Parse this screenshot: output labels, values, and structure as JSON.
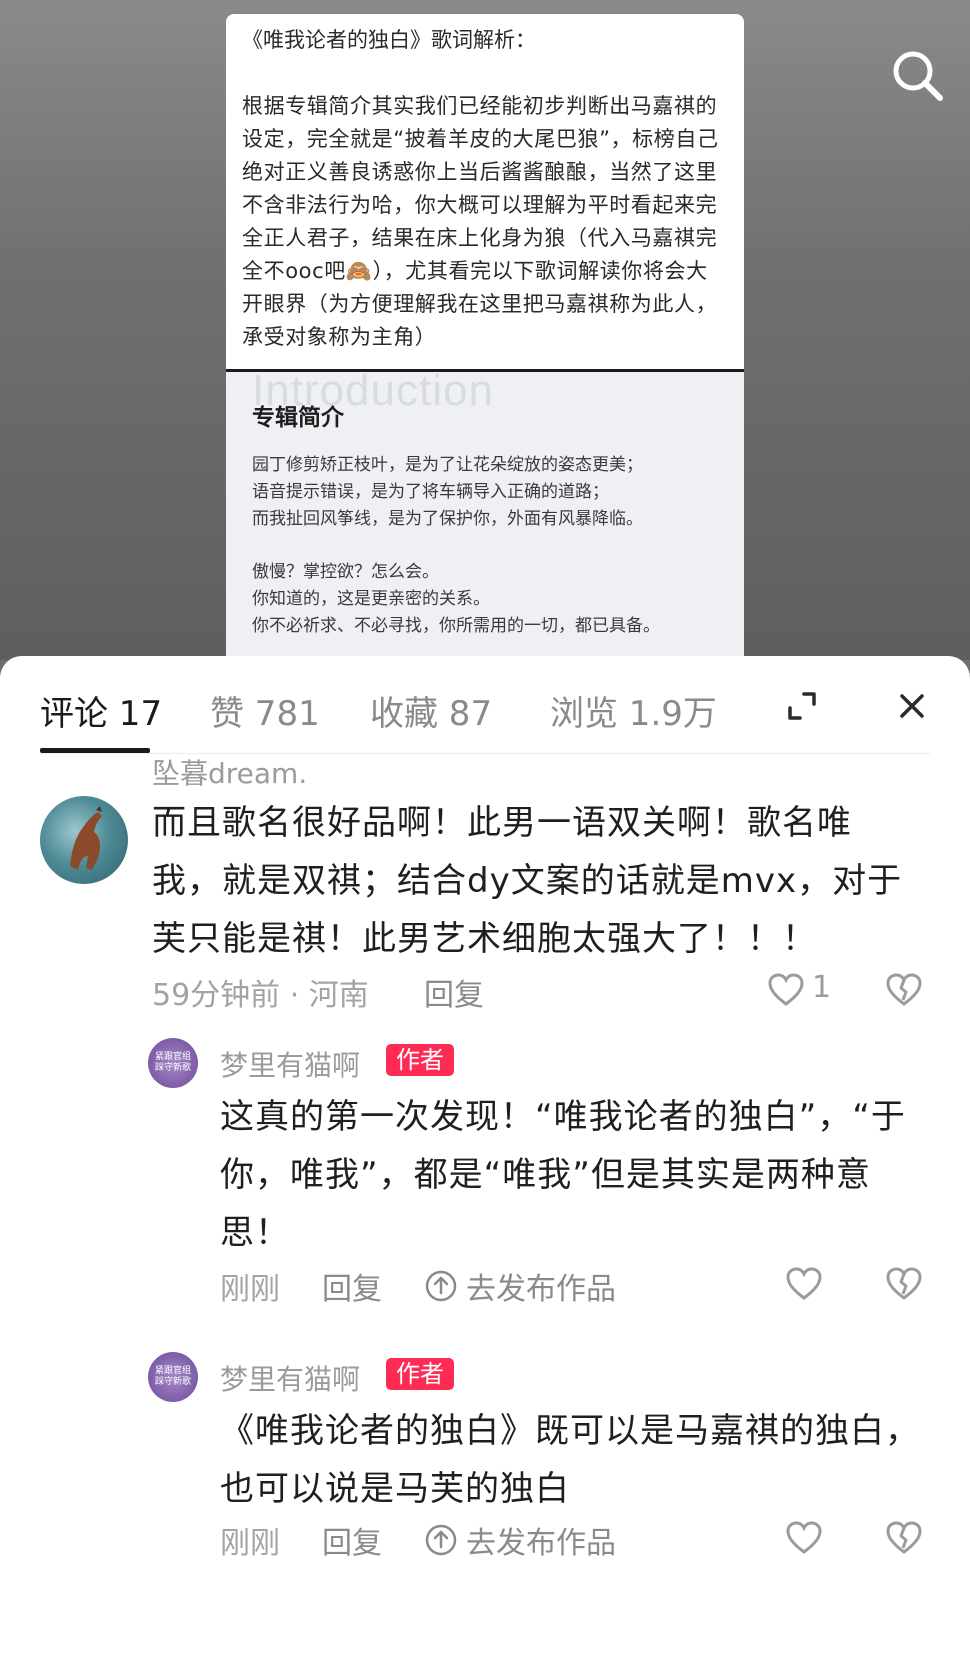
{
  "note": {
    "title": "《唯我论者的独白》歌词解析：",
    "body": "根据专辑简介其实我们已经能初步判断出马嘉祺的设定，完全就是“披着羊皮的大尾巴狼”，标榜自己绝对正义善良诱惑你上当后酱酱酿酿，当然了这里不含非法行为哈，你大概可以理解为平时看起来完全正人君子，结果在床上化身为狼（代入马嘉祺完全不ooc吧🙈），尤其看完以下歌词解读你将会大开眼界（为方便理解我在这里把马嘉祺称为此人，承受对象称为主角）"
  },
  "album": {
    "watermark": "Introduction",
    "heading": "专辑简介",
    "lines1": [
      "园丁修剪矫正枝叶，是为了让花朵绽放的姿态更美；",
      "语音提示错误，是为了将车辆导入正确的道路；",
      "而我扯回风筝线，是为了保护你，外面有风暴降临。"
    ],
    "lines2": [
      "傲慢？掌控欲？怎么会。",
      "你知道的，这是更亲密的关系。",
      "你不必祈求、不必寻找，你所需用的一切，都已具备。"
    ]
  },
  "tabs": {
    "comments": "评论 17",
    "likes": "赞 781",
    "favorites": "收藏 87",
    "views": "浏览 1.9万"
  },
  "comments": [
    {
      "username": "坠暮dream.",
      "text": "而且歌名很好品啊！此男一语双关啊！歌名唯我，就是双祺；结合dy文案的话就是mvx，对于芙只能是祺！此男艺术细胞太强大了！！！",
      "time_location": "59分钟前 · 河南",
      "reply": "回复",
      "likes": "1"
    }
  ],
  "replies": [
    {
      "username": "梦里有猫啊",
      "badge": "作者",
      "avatar_text": "紧跟官组\n踩守新歌",
      "text": "这真的第一次发现！“唯我论者的独白”，“于你，唯我”，都是“唯我”但是其实是两种意思！",
      "time": "刚刚",
      "reply": "回复",
      "publish": "去发布作品"
    },
    {
      "username": "梦里有猫啊",
      "badge": "作者",
      "avatar_text": "紧跟官组\n踩守新歌",
      "text": "《唯我论者的独白》既可以是马嘉祺的独白，也可以说是马芙的独白",
      "time": "刚刚",
      "reply": "回复",
      "publish": "去发布作品"
    }
  ],
  "icons": [
    "search-icon",
    "expand-icon",
    "close-icon",
    "heart-icon",
    "broken-heart-icon",
    "upload-circle-icon"
  ],
  "colors": {
    "author_badge": "#fe2c55",
    "text_primary": "#1f1f1f",
    "text_muted": "#9b9b9b"
  }
}
